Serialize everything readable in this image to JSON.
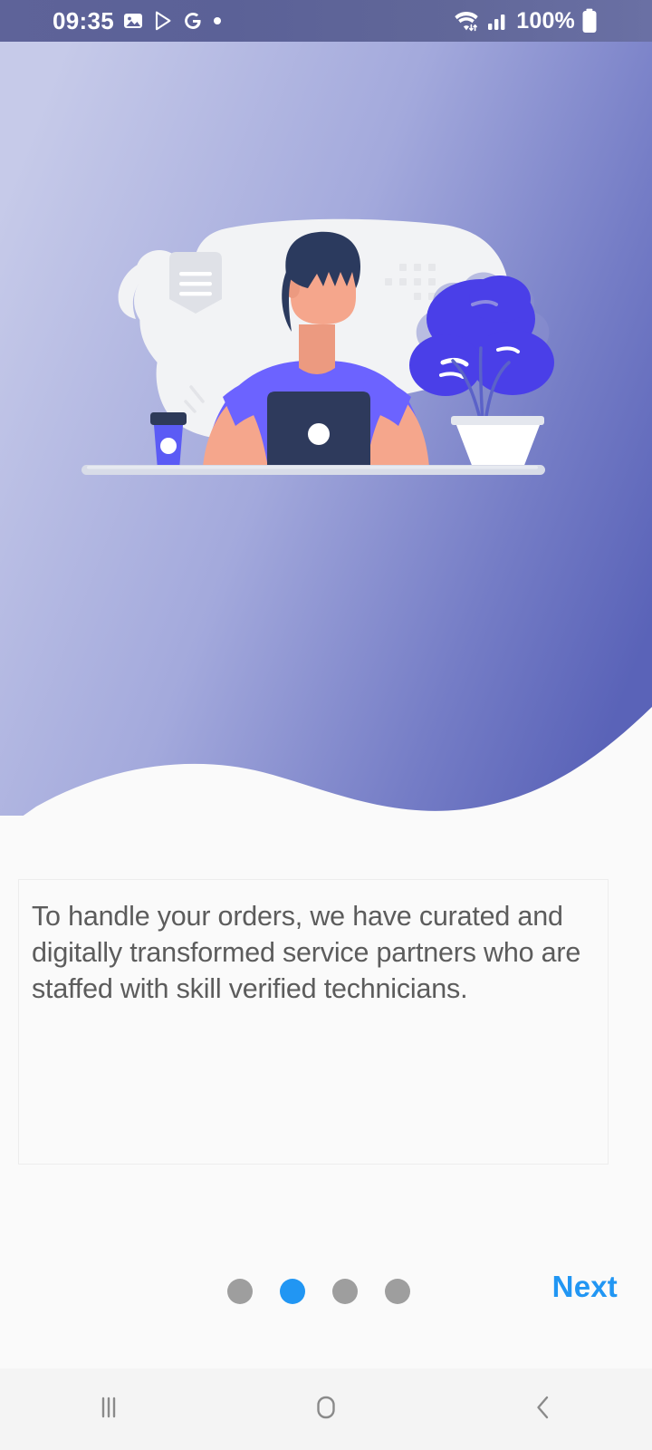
{
  "status_bar": {
    "time": "09:35",
    "battery_percent": "100%",
    "left_icons": [
      "gallery-icon",
      "play-store-icon",
      "google-icon",
      "dot-indicator-icon"
    ],
    "right_icons": [
      "wifi-icon",
      "cellular-signal-icon",
      "battery-icon"
    ],
    "background_color": "#5E6399",
    "foreground_color": "#FFFFFF"
  },
  "hero": {
    "gradient_from": "#C6CAE9",
    "gradient_to": "#5A63B8",
    "wave_color": "#FAFAFA",
    "illustration": {
      "name": "person-working-on-laptop-illustration",
      "blob_color": "#F2F3F5",
      "skin_color": "#F5A68C",
      "hair_color": "#2B3A5E",
      "shirt_color": "#6C63FF",
      "laptop_color": "#2E3A5C",
      "accent_color": "#4A3FE8",
      "desk_color": "#D8DCE8",
      "elements": [
        "document-shield-icon",
        "dot-grid-decoration",
        "coffee-cup-icon",
        "monstera-plant-icon",
        "laptop-icon",
        "desk-shelf"
      ]
    }
  },
  "main": {
    "description": "To handle your orders, we have curated and digitally transformed service partners who are staffed with skill verified technicians.",
    "description_color": "#5C5C5C",
    "box_border_color": "#EDEDED",
    "background_color": "#FAFAFA"
  },
  "pager": {
    "total": 4,
    "active_index": 1,
    "active_color": "#2196F3",
    "inactive_color": "#9E9E9E"
  },
  "footer": {
    "next_label": "Next",
    "next_color": "#2196F3"
  },
  "nav_bar": {
    "background_color": "#F4F4F4",
    "icon_color": "#8A8A8A",
    "buttons": [
      {
        "name": "recents-icon",
        "label": "Recents"
      },
      {
        "name": "home-icon",
        "label": "Home"
      },
      {
        "name": "back-icon",
        "label": "Back"
      }
    ]
  }
}
